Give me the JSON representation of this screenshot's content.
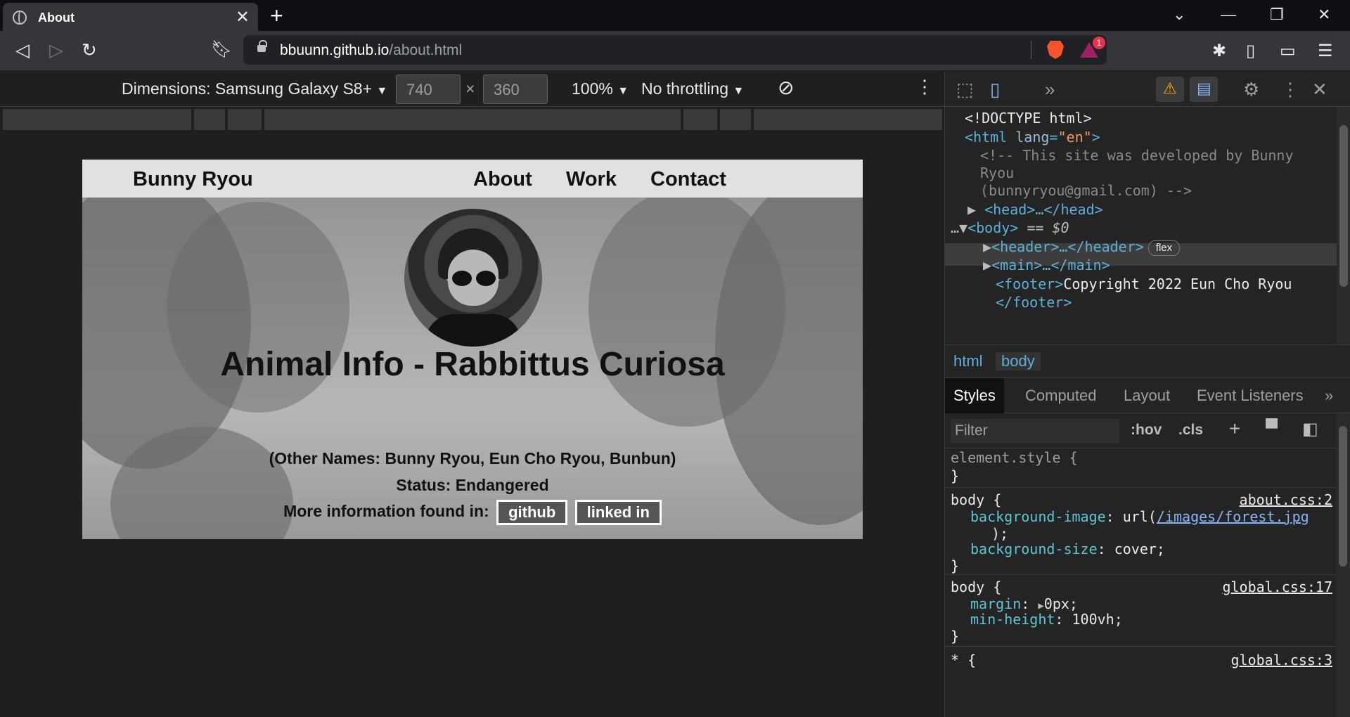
{
  "browser": {
    "tab_title": "About",
    "url_host": "bbuunn.github.io",
    "url_path": "/about.html",
    "shield_badge": "1"
  },
  "device_toolbar": {
    "device": "Dimensions: Samsung Galaxy S8+",
    "width": "740",
    "height": "360",
    "times": "×",
    "zoom": "100%",
    "throttling": "No throttling",
    "dropdown_arrow": "▼"
  },
  "site": {
    "brand": "Bunny Ryou",
    "nav": [
      "About",
      "Work",
      "Contact"
    ],
    "title": "Animal Info - Rabbittus Curiosa",
    "other_names": "(Other Names: Bunny Ryou, Eun Cho Ryou, Bunbun)",
    "status": "Status: Endangered",
    "more_info": "More information found in:",
    "links": [
      "github",
      "linked in"
    ]
  },
  "devtools": {
    "dom": {
      "doctype": "<!DOCTYPE html>",
      "html_open": "<html",
      "lang_attr": "lang",
      "lang_val": "\"en\"",
      "comment_1": "<!-- This site was developed by Bunny",
      "comment_2": "Ryou",
      "comment_3": "(bunnyryou@gmail.com) -->",
      "head": "<head>…</head>",
      "body": "<body>",
      "body_eq": "== $0",
      "header": "<header>…</header>",
      "flex_badge": "flex",
      "main": "<main>…</main>",
      "footer_tag": "<footer>",
      "footer_text": "Copyright 2022 Eun Cho Ryou",
      "footer_close": "</footer>"
    },
    "breadcrumbs": [
      "html",
      "body"
    ],
    "tabs": [
      "Styles",
      "Computed",
      "Layout",
      "Event Listeners"
    ],
    "filter_placeholder": "Filter",
    "hov": ":hov",
    "cls": ".cls",
    "rules": {
      "element_style": "element.style {",
      "close": "}",
      "body_sel": "body {",
      "bg_image_prop": "background-image",
      "bg_image_fn": "url(",
      "bg_image_link": "/images/forest.jpg",
      "bg_image_end": ");",
      "bg_size_prop": "background-size",
      "bg_size_val": "cover;",
      "src_about": "about.css:2",
      "margin_prop": "margin",
      "margin_val": "0px;",
      "minh_prop": "min-height",
      "minh_val": "100vh;",
      "src_global17": "global.css:17",
      "star_sel": "* {",
      "src_global3": "global.css:3"
    }
  }
}
